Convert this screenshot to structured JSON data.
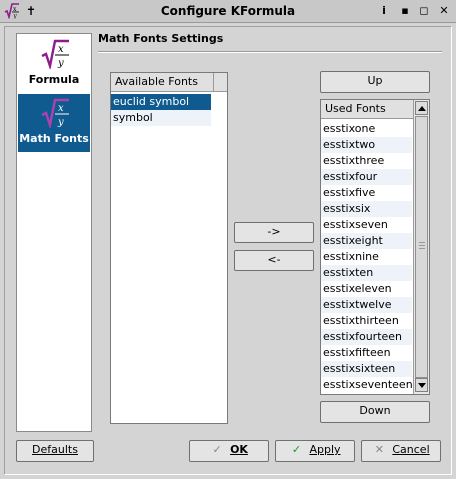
{
  "window": {
    "title": "Configure KFormula",
    "pin_glyph": "✝",
    "help_glyph": "i",
    "min_glyph": "▪",
    "max_glyph": "◻",
    "close_glyph": "✕"
  },
  "sidebar": {
    "items": [
      {
        "label": "Formula",
        "icon": "formula-icon",
        "active": false
      },
      {
        "label": "Math Fonts",
        "icon": "math-fonts-icon",
        "active": true
      }
    ]
  },
  "section_title": "Math Fonts Settings",
  "available": {
    "header": "Available Fonts",
    "items": [
      "euclid symbol",
      "symbol"
    ]
  },
  "used": {
    "header": "Used Fonts",
    "items": [
      "esstixone",
      "esstixtwo",
      "esstixthree",
      "esstixfour",
      "esstixfive",
      "esstixsix",
      "esstixseven",
      "esstixeight",
      "esstixnine",
      "esstixten",
      "esstixeleven",
      "esstixtwelve",
      "esstixthirteen",
      "esstixfourteen",
      "esstixfifteen",
      "esstixsixteen",
      "esstixseventeen"
    ]
  },
  "buttons": {
    "up": "Up",
    "down": "Down",
    "add": "->",
    "remove": "<-",
    "defaults": "Defaults",
    "ok": "OK",
    "apply": "Apply",
    "cancel": "Cancel"
  },
  "icons": {
    "ok": "check-gray-icon",
    "apply": "check-green-icon",
    "cancel": "x-icon"
  },
  "colors": {
    "selection": "#0f5a8e",
    "apply_check": "#1a9c1a",
    "icon_purple": "#8e1c8e"
  }
}
